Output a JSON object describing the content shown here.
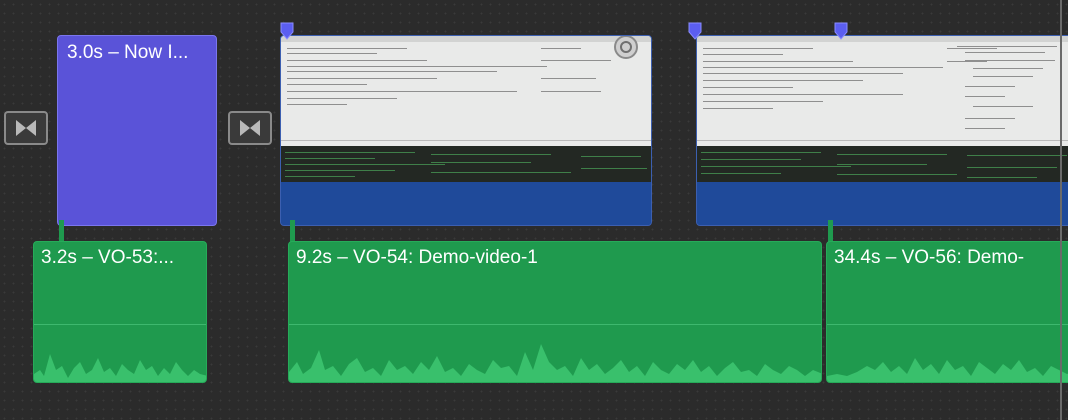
{
  "timeline": {
    "title_clip": {
      "label": "3.0s – Now I..."
    },
    "transitions": [
      {
        "icon": "cross-dissolve-transition-icon"
      },
      {
        "icon": "cross-dissolve-transition-icon"
      }
    ],
    "video_clips": [
      {
        "kind": "screen-recording"
      },
      {
        "kind": "screen-recording"
      }
    ],
    "audio_clips": [
      {
        "label": "3.2s – VO-53:..."
      },
      {
        "label": "9.2s – VO-54: Demo-video-1"
      },
      {
        "label": "34.4s – VO-56: Demo-"
      }
    ]
  },
  "colors": {
    "title_clip": "#5a53d8",
    "video_clip": "#1f4a9a",
    "audio_clip": "#1f9a4e",
    "marker": "#5b5ef0",
    "background": "#2b2b2b"
  }
}
